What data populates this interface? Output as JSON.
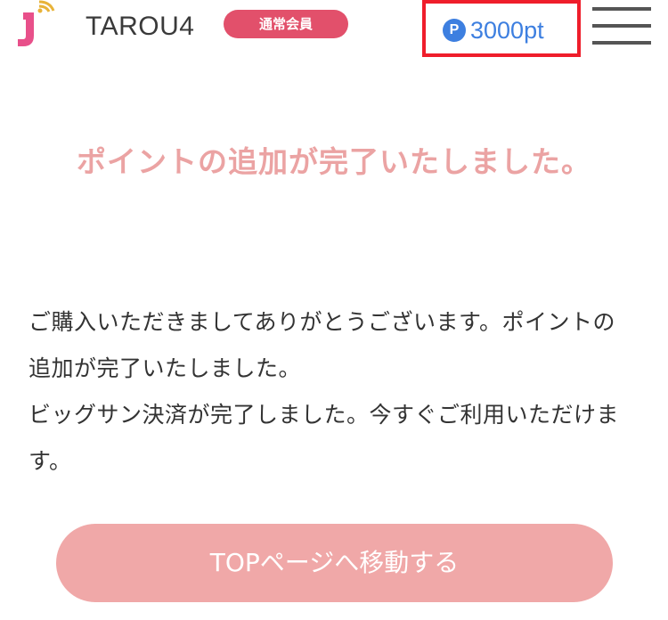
{
  "header": {
    "logo_icon": "j-logo-icon",
    "username": "TAROU4",
    "member_badge": "通常会員",
    "points": {
      "icon_letter": "P",
      "value": "3000pt",
      "highlight_color": "#ef1d2b",
      "text_color": "#3d7fe0"
    },
    "menu_icon": "hamburger-menu-icon"
  },
  "main": {
    "title": "ポイントの追加が完了いたしました。",
    "message_lines": [
      "ご購入いただきましてありがとうございます。ポイントの追加が完了いたしました。",
      "ビッグサン決済が完了しました。今すぐご利用いただけます。"
    ],
    "top_button_label": "TOPページへ移動する"
  },
  "colors": {
    "title": "#eba3a3",
    "badge": "#e2506b",
    "button": "#f0a8a8",
    "logo_pink": "#e8508a",
    "logo_gold": "#e8b339"
  }
}
